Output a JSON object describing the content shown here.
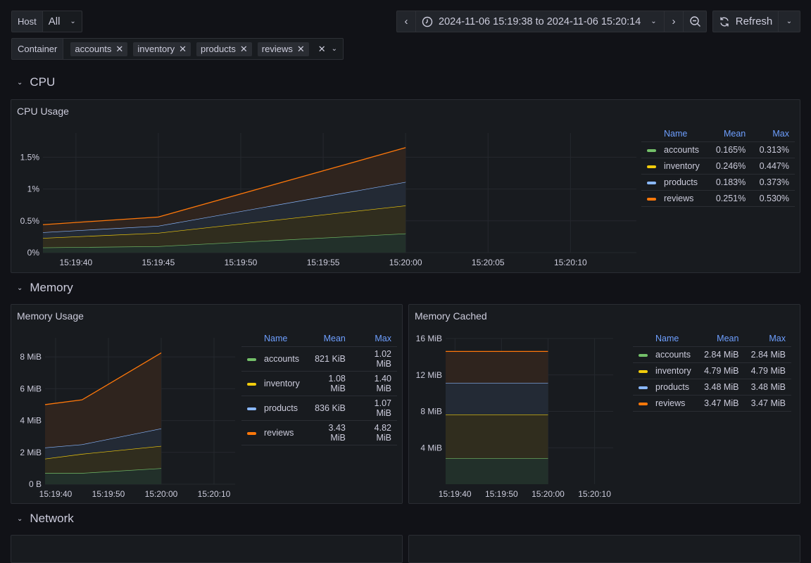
{
  "variables": {
    "host": {
      "label": "Host",
      "value": "All"
    },
    "container": {
      "label": "Container",
      "values": [
        "accounts",
        "inventory",
        "products",
        "reviews"
      ]
    }
  },
  "toolbar": {
    "time_range": "2024-11-06 15:19:38 to 2024-11-06 15:20:14",
    "refresh_label": "Refresh"
  },
  "colors": {
    "accounts": "#73bf69",
    "inventory": "#f2cc0c",
    "products": "#8ab8ff",
    "reviews": "#ff780a",
    "legend_header": "#6e9fff"
  },
  "rows": [
    {
      "title": "CPU"
    },
    {
      "title": "Memory"
    },
    {
      "title": "Network"
    }
  ],
  "legend_headers": {
    "name": "Name",
    "mean": "Mean",
    "max": "Max"
  },
  "panels": {
    "cpu": {
      "title": "CPU Usage",
      "legend": [
        {
          "name": "accounts",
          "mean": "0.165%",
          "max": "0.313%"
        },
        {
          "name": "inventory",
          "mean": "0.246%",
          "max": "0.447%"
        },
        {
          "name": "products",
          "mean": "0.183%",
          "max": "0.373%"
        },
        {
          "name": "reviews",
          "mean": "0.251%",
          "max": "0.530%"
        }
      ]
    },
    "mem_usage": {
      "title": "Memory Usage",
      "legend": [
        {
          "name": "accounts",
          "mean": "821 KiB",
          "max": "1.02 MiB"
        },
        {
          "name": "inventory",
          "mean": "1.08 MiB",
          "max": "1.40 MiB"
        },
        {
          "name": "products",
          "mean": "836 KiB",
          "max": "1.07 MiB"
        },
        {
          "name": "reviews",
          "mean": "3.43 MiB",
          "max": "4.82 MiB"
        }
      ]
    },
    "mem_cached": {
      "title": "Memory Cached",
      "legend": [
        {
          "name": "accounts",
          "mean": "2.84 MiB",
          "max": "2.84 MiB"
        },
        {
          "name": "inventory",
          "mean": "4.79 MiB",
          "max": "4.79 MiB"
        },
        {
          "name": "products",
          "mean": "3.48 MiB",
          "max": "3.48 MiB"
        },
        {
          "name": "reviews",
          "mean": "3.47 MiB",
          "max": "3.47 MiB"
        }
      ]
    }
  },
  "chart_data": [
    {
      "id": "cpu",
      "type": "area",
      "stacked": true,
      "title": "CPU Usage",
      "x": [
        "15:19:38",
        "15:19:45",
        "15:20:00"
      ],
      "x_seconds": [
        -2,
        5,
        20
      ],
      "xlim_seconds": [
        -2,
        34
      ],
      "xticks": [
        {
          "s": 0,
          "label": "15:19:40"
        },
        {
          "s": 5,
          "label": "15:19:45"
        },
        {
          "s": 10,
          "label": "15:19:50"
        },
        {
          "s": 15,
          "label": "15:19:55"
        },
        {
          "s": 20,
          "label": "15:20:00"
        },
        {
          "s": 25,
          "label": "15:20:05"
        },
        {
          "s": 30,
          "label": "15:20:10"
        }
      ],
      "yticks": [
        {
          "v": 0,
          "label": "0%"
        },
        {
          "v": 0.5,
          "label": "0.5%"
        },
        {
          "v": 1,
          "label": "1%"
        },
        {
          "v": 1.5,
          "label": "1.5%"
        }
      ],
      "ylim": [
        0,
        1.88
      ],
      "series": [
        {
          "name": "accounts",
          "values": [
            0.08,
            0.1,
            0.3
          ]
        },
        {
          "name": "inventory",
          "values": [
            0.15,
            0.21,
            0.44
          ]
        },
        {
          "name": "products",
          "values": [
            0.09,
            0.11,
            0.37
          ]
        },
        {
          "name": "reviews",
          "values": [
            0.12,
            0.14,
            0.54
          ]
        }
      ]
    },
    {
      "id": "mem_usage",
      "type": "area",
      "stacked": true,
      "title": "Memory Usage",
      "x": [
        "15:19:38",
        "15:19:45",
        "15:20:00"
      ],
      "x_seconds": [
        -2,
        5,
        20
      ],
      "xlim_seconds": [
        -2,
        34
      ],
      "xticks": [
        {
          "s": 0,
          "label": "15:19:40"
        },
        {
          "s": 10,
          "label": "15:19:50"
        },
        {
          "s": 20,
          "label": "15:20:00"
        },
        {
          "s": 30,
          "label": "15:20:10"
        }
      ],
      "yticks": [
        {
          "v": 0,
          "label": "0 B"
        },
        {
          "v": 2,
          "label": "2 MiB"
        },
        {
          "v": 4,
          "label": "4 MiB"
        },
        {
          "v": 6,
          "label": "6 MiB"
        },
        {
          "v": 8,
          "label": "8 MiB"
        }
      ],
      "ylim": [
        0,
        9.2
      ],
      "series": [
        {
          "name": "accounts",
          "values": [
            0.7,
            0.7,
            1.0
          ]
        },
        {
          "name": "inventory",
          "values": [
            0.9,
            1.2,
            1.4
          ]
        },
        {
          "name": "products",
          "values": [
            0.7,
            0.6,
            1.1
          ]
        },
        {
          "name": "reviews",
          "values": [
            2.7,
            2.8,
            4.75
          ]
        }
      ]
    },
    {
      "id": "mem_cached",
      "type": "area",
      "stacked": true,
      "title": "Memory Cached",
      "x": [
        "15:19:38",
        "15:19:45",
        "15:20:00"
      ],
      "x_seconds": [
        -2,
        5,
        20
      ],
      "xlim_seconds": [
        -2,
        34
      ],
      "xticks": [
        {
          "s": 0,
          "label": "15:19:40"
        },
        {
          "s": 10,
          "label": "15:19:50"
        },
        {
          "s": 20,
          "label": "15:20:00"
        },
        {
          "s": 30,
          "label": "15:20:10"
        }
      ],
      "yticks": [
        {
          "v": 4,
          "label": "4 MiB"
        },
        {
          "v": 8,
          "label": "8 MiB"
        },
        {
          "v": 12,
          "label": "12 MiB"
        },
        {
          "v": 16,
          "label": "16 MiB"
        }
      ],
      "ylim": [
        0,
        16
      ],
      "series": [
        {
          "name": "accounts",
          "values": [
            2.84,
            2.84,
            2.84
          ]
        },
        {
          "name": "inventory",
          "values": [
            4.79,
            4.79,
            4.79
          ]
        },
        {
          "name": "products",
          "values": [
            3.48,
            3.48,
            3.48
          ]
        },
        {
          "name": "reviews",
          "values": [
            3.47,
            3.47,
            3.47
          ]
        }
      ]
    }
  ]
}
